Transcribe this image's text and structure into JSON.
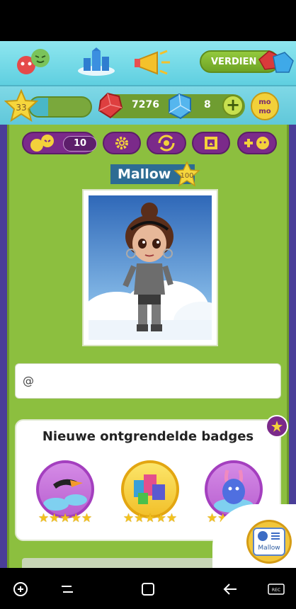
{
  "header": {
    "earn_label": "VERDIEN",
    "icons": [
      "friends-icon",
      "city-icon",
      "megaphone-icon",
      "gems-icon"
    ]
  },
  "resources": {
    "level": "33",
    "xp_fraction": 0.3,
    "rubies": "7276",
    "diamonds": "8",
    "plus_label": "+",
    "momo_label": "mo mo"
  },
  "profile": {
    "friends_count": "10",
    "username": "Mallow",
    "level_badge": "100",
    "toolbar_icons": [
      "friends-icon",
      "gear-icon",
      "change-outfit-icon",
      "frame-icon",
      "add-friend-icon"
    ],
    "status_icon": "spiral-icon",
    "status_text": "@"
  },
  "badges": {
    "title": "Nieuwe ontgrendelde badges",
    "items": [
      {
        "name": "toucan-badge",
        "stars": 5,
        "ring": "#a43fbf"
      },
      {
        "name": "shopping-badge",
        "stars": 5,
        "ring": "#f2c02a"
      },
      {
        "name": "bunny-badge",
        "stars": 5,
        "ring": "#a43fbf"
      }
    ]
  },
  "album": {
    "label": "Mallow"
  },
  "colors": {
    "panel": "#8cbf3f",
    "accent_purple": "#7b2a8a",
    "topbar": "#6fd6e6"
  }
}
